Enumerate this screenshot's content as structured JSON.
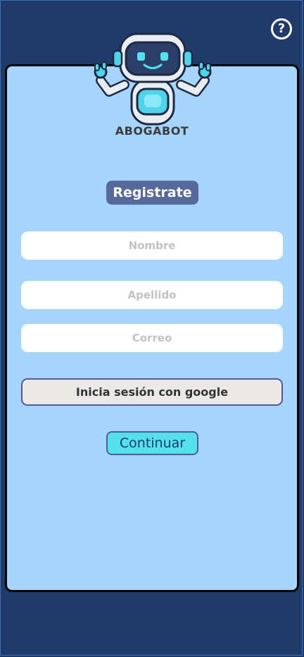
{
  "header": {
    "help_icon": "question-circle-icon",
    "help_glyph": "?"
  },
  "brand": {
    "name": "ABOGABOT",
    "logo_icon": "robot-mascot-icon"
  },
  "form": {
    "title": "Registrate",
    "fields": {
      "first_name": {
        "placeholder": "Nombre",
        "value": ""
      },
      "last_name": {
        "placeholder": "Apellido",
        "value": ""
      },
      "email": {
        "placeholder": "Correo",
        "value": ""
      }
    },
    "google_label": "Inicia sesión con google",
    "continue_label": "Continuar"
  },
  "colors": {
    "background": "#1f3a6b",
    "card": "#a5d5fd",
    "title_badge": "#56699a",
    "continue_button": "#55e0ee",
    "google_button": "#ebe8e8"
  }
}
